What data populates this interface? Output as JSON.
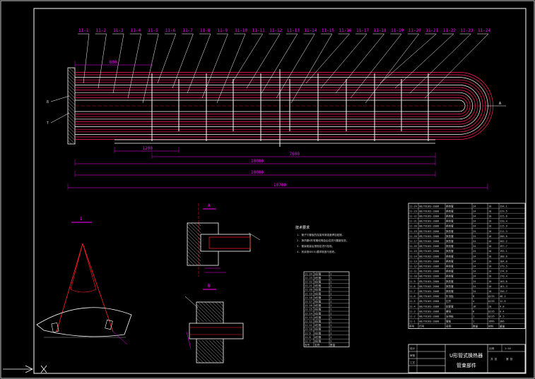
{
  "drawing": {
    "balloons": [
      "11-1",
      "11-2",
      "11-3",
      "11-4",
      "11-5",
      "11-6",
      "11-7",
      "11-8",
      "11-9",
      "11-10",
      "11-11",
      "11-12",
      "11-13",
      "11-14",
      "11-15",
      "11-16",
      "11-17",
      "11-18",
      "11-19",
      "11-20",
      "11-21",
      "11-22",
      "11-23",
      "11-24"
    ],
    "left_marks": [
      "B",
      "T"
    ],
    "right_mark": "A",
    "dimension_labels": [
      "800",
      "1200",
      "7600",
      "10000",
      "10700"
    ],
    "detail_labels": [
      "A",
      "B",
      "I"
    ],
    "tech_notes": {
      "title": "技术要求",
      "lines": [
        "1. 管子与管板的连接采用强度焊加贴胀。",
        "2. 换热管U形弯管段弯曲后应进行圆度检查。",
        "3. 管束组装后按规定进行检验。",
        "4. 其余按GB151要求制造与验收。"
      ]
    }
  },
  "parts_list_small": {
    "rows": [
      [
        "11-24",
        "U形管",
        "1"
      ],
      [
        "11-23",
        "U形管",
        "1"
      ],
      [
        "11-22",
        "U形管",
        "1"
      ],
      [
        "11-21",
        "U形管",
        "1"
      ],
      [
        "11-20",
        "U形管",
        "1"
      ],
      [
        "11-19",
        "U形管",
        "1"
      ],
      [
        "11-18",
        "U形管",
        "1"
      ],
      [
        "11-17",
        "U形管",
        "1"
      ],
      [
        "11-16",
        "U形管",
        "1"
      ],
      [
        "11-15",
        "U形管",
        "1"
      ],
      [
        "11-14",
        "U形管",
        "1"
      ],
      [
        "11-13",
        "U形管",
        "1"
      ],
      [
        "11-12",
        "U形管",
        "1"
      ],
      [
        "11-11",
        "U形管",
        "1"
      ],
      [
        "11-10",
        "U形管",
        "1"
      ],
      [
        "11-9",
        "U形管",
        "1"
      ],
      [
        "11-8",
        "U形管",
        "1"
      ],
      [
        "11-7",
        "U形管",
        "1"
      ]
    ],
    "footer": [
      "序号",
      "名称",
      "数量"
    ]
  },
  "parts_list_main": {
    "rows": [
      [
        "11-24",
        "GB/T8163-2008",
        "换热管",
        "24",
        "10",
        "234.1"
      ],
      [
        "11-23",
        "GB/T8163-2008",
        "换热管",
        "24",
        "10",
        "229.5"
      ],
      [
        "11-22",
        "GB/T8163-2008",
        "换热管",
        "24",
        "10",
        "225.0"
      ],
      [
        "11-21",
        "GB/T8163-2008",
        "换热管",
        "24",
        "10",
        "220.4"
      ],
      [
        "11-20",
        "GB/T8163-2008",
        "换热管",
        "24",
        "10",
        "215.9"
      ],
      [
        "11-19",
        "GB/T8163-2008",
        "换热管",
        "24",
        "10",
        "211.3"
      ],
      [
        "11-18",
        "GB/T8163-2008",
        "换热管",
        "24",
        "10",
        "206.8"
      ],
      [
        "11-17",
        "GB/T8163-2008",
        "换热管",
        "24",
        "10",
        "202.2"
      ],
      [
        "11-16",
        "GB/T8163-2008",
        "换热管",
        "24",
        "10",
        "197.7"
      ],
      [
        "11-15",
        "GB/T8163-2008",
        "换热管",
        "24",
        "10",
        "193.1"
      ],
      [
        "11-14",
        "GB/T8163-2008",
        "换热管",
        "24",
        "10",
        "188.6"
      ],
      [
        "11-13",
        "GB/T8163-2008",
        "换热管",
        "24",
        "10",
        "184.0"
      ],
      [
        "11-12",
        "GB/T8163-2008",
        "换热管",
        "24",
        "10",
        "179.5"
      ],
      [
        "11-11",
        "GB/T8163-2008",
        "换热管",
        "24",
        "10",
        "174.9"
      ],
      [
        "11-10",
        "GB/T8163-2008",
        "换热管",
        "24",
        "10",
        "170.4"
      ],
      [
        "11-9",
        "GB/T8163-2008",
        "换热管",
        "24",
        "10",
        "165.8"
      ],
      [
        "11-8",
        "GB/T8163-2008",
        "换热管",
        "24",
        "10",
        "161.3"
      ],
      [
        "11-7",
        "GB/T8163-2008",
        "换热管",
        "24",
        "10",
        "156.7"
      ],
      [
        "11-6",
        "GB/T8163-2008",
        "折流板",
        "8",
        "Q235",
        "48.2"
      ],
      [
        "11-5",
        "GB/T8163-2008",
        "拉杆",
        "4",
        "Q235",
        "12.6"
      ],
      [
        "11-4",
        "GB/T8163-2008",
        "定距管",
        "16",
        "20",
        "9.8"
      ],
      [
        "11-3",
        "GB/T8163-2008",
        "螺母",
        "8",
        "Q235",
        "0.4"
      ],
      [
        "11-2",
        "GB/T8163-2008",
        "支持板",
        "1",
        "Q235",
        "6.5"
      ],
      [
        "11-1",
        "GB/T8163-2008",
        "管板",
        "1",
        "16Mn",
        "386"
      ]
    ],
    "header": [
      "序号",
      "代号",
      "名称",
      "数量",
      "材料",
      "重量"
    ]
  },
  "title_block": {
    "drawing_title": "U形管式换热器",
    "subtitle": "管束部件",
    "fields": [
      "设计",
      "审核",
      "工艺",
      "比例",
      "1:10",
      "共 张",
      "第 张"
    ]
  }
}
